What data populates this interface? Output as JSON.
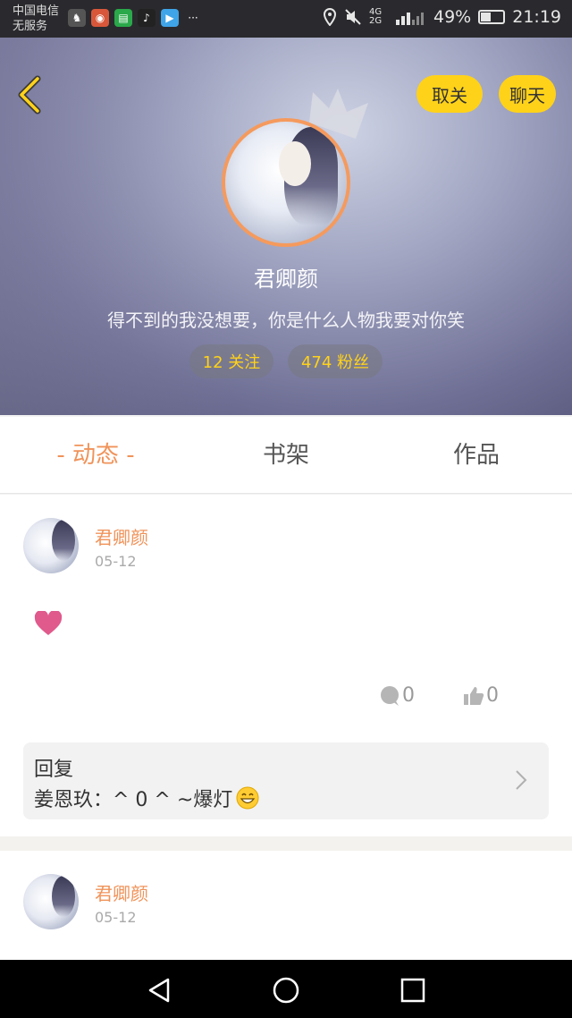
{
  "status_bar": {
    "carrier_line1": "中国电信",
    "carrier_line2": "无服务",
    "network": "4G 2G",
    "battery": "49%",
    "time": "21:19"
  },
  "header": {
    "unfollow_label": "取关",
    "chat_label": "聊天",
    "username": "君卿颜",
    "bio": "得不到的我没想要，你是什么人物我要对你笑",
    "following": "12 关注",
    "followers": "474 粉丝"
  },
  "tabs": [
    {
      "label": "- 动态 -",
      "active": true
    },
    {
      "label": "书架",
      "active": false
    },
    {
      "label": "作品",
      "active": false
    }
  ],
  "posts": [
    {
      "author": "君卿颜",
      "date": "05-12",
      "content_icon": "heart-icon",
      "comment_count": "0",
      "like_count": "0",
      "reply_title": "回复",
      "reply_text": "姜恩玖：^ 0 ^ ~爆灯",
      "reply_emoji": "grin-emoji"
    },
    {
      "author": "君卿颜",
      "date": "05-12"
    }
  ],
  "colors": {
    "accent": "#f0935a",
    "yellow": "#ffd21a",
    "heart": "#e05a8c"
  }
}
